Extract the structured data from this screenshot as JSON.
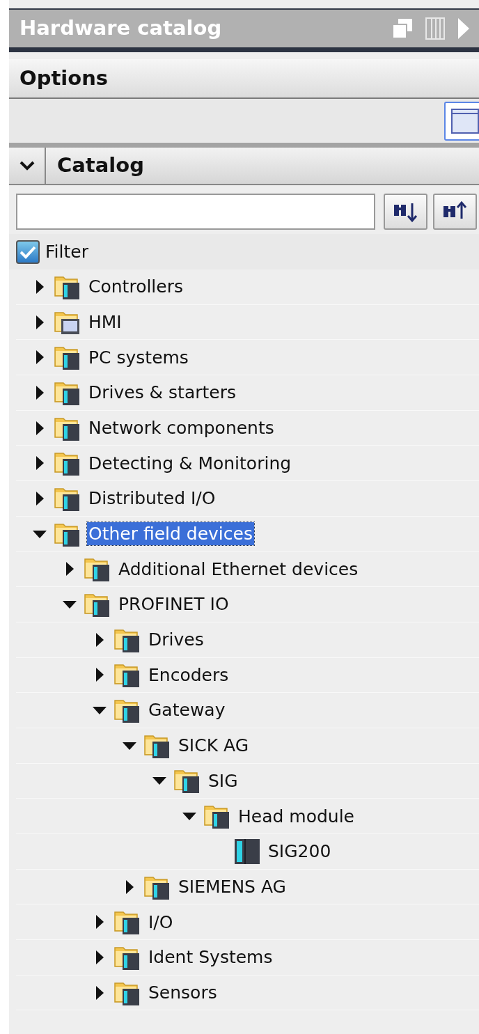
{
  "window": {
    "title": "Hardware catalog"
  },
  "options": {
    "title": "Options"
  },
  "catalog": {
    "title": "Catalog",
    "expanded": true,
    "filter": {
      "label": "Filter",
      "checked": true
    },
    "tree": [
      {
        "label": "Controllers",
        "kind": "folder",
        "expanded": false,
        "selected": false
      },
      {
        "label": "HMI",
        "kind": "hmi_folder",
        "expanded": false,
        "selected": false
      },
      {
        "label": "PC systems",
        "kind": "folder",
        "expanded": false,
        "selected": false
      },
      {
        "label": "Drives & starters",
        "kind": "folder",
        "expanded": false,
        "selected": false
      },
      {
        "label": "Network components",
        "kind": "folder",
        "expanded": false,
        "selected": false
      },
      {
        "label": "Detecting & Monitoring",
        "kind": "folder",
        "expanded": false,
        "selected": false
      },
      {
        "label": "Distributed I/O",
        "kind": "folder",
        "expanded": false,
        "selected": false
      },
      {
        "label": "Other field devices",
        "kind": "folder",
        "expanded": true,
        "selected": true,
        "children": [
          {
            "label": "Additional Ethernet devices",
            "kind": "folder",
            "expanded": false,
            "selected": false
          },
          {
            "label": "PROFINET IO",
            "kind": "folder",
            "expanded": true,
            "selected": false,
            "children": [
              {
                "label": "Drives",
                "kind": "folder",
                "expanded": false,
                "selected": false
              },
              {
                "label": "Encoders",
                "kind": "folder",
                "expanded": false,
                "selected": false
              },
              {
                "label": "Gateway",
                "kind": "folder",
                "expanded": true,
                "selected": false,
                "children": [
                  {
                    "label": "SICK AG",
                    "kind": "folder",
                    "expanded": true,
                    "selected": false,
                    "children": [
                      {
                        "label": "SIG",
                        "kind": "folder",
                        "expanded": true,
                        "selected": false,
                        "children": [
                          {
                            "label": "Head module",
                            "kind": "folder",
                            "expanded": true,
                            "selected": false,
                            "children": [
                              {
                                "label": "SIG200",
                                "kind": "device",
                                "selected": false
                              }
                            ]
                          }
                        ]
                      }
                    ]
                  },
                  {
                    "label": "SIEMENS AG",
                    "kind": "folder",
                    "expanded": false,
                    "selected": false
                  }
                ]
              },
              {
                "label": "I/O",
                "kind": "folder",
                "expanded": false,
                "selected": false
              },
              {
                "label": "Ident Systems",
                "kind": "folder",
                "expanded": false,
                "selected": false
              },
              {
                "label": "Sensors",
                "kind": "folder",
                "expanded": false,
                "selected": false
              }
            ]
          }
        ]
      }
    ]
  }
}
